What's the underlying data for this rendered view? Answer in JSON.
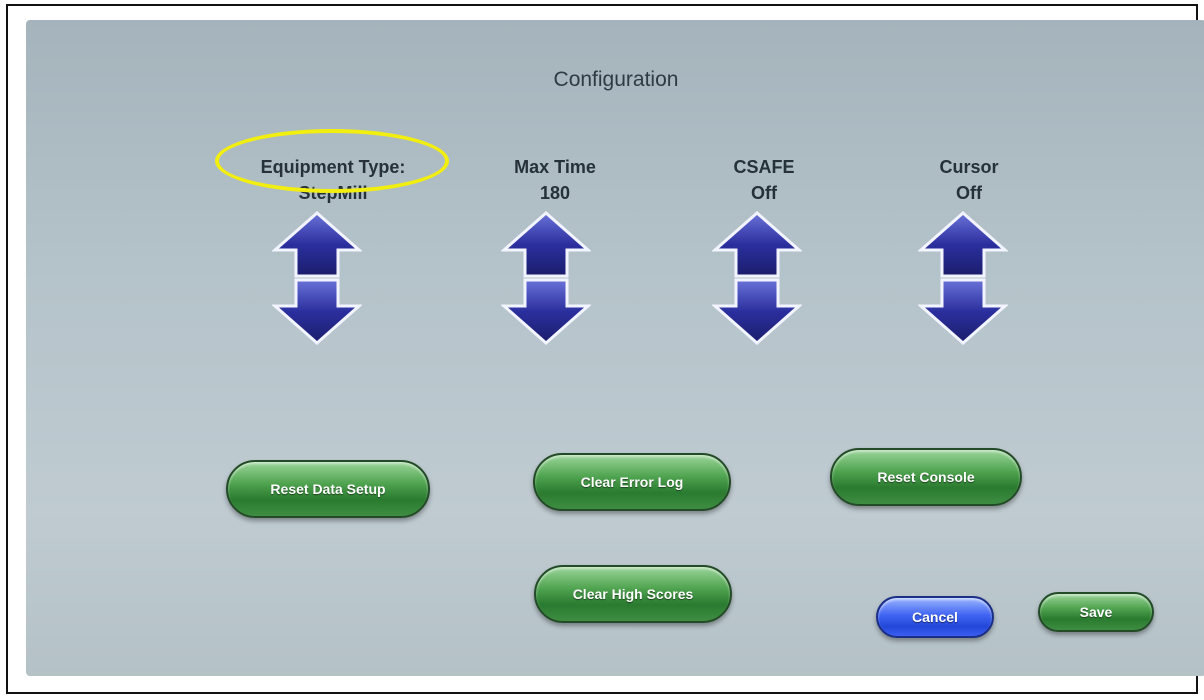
{
  "screen": {
    "title": "Configuration"
  },
  "settings": [
    {
      "label": "Equipment Type:",
      "value": "StepMill"
    },
    {
      "label": "Max Time",
      "value": "180"
    },
    {
      "label": "CSAFE",
      "value": "Off"
    },
    {
      "label": "Cursor",
      "value": "Off"
    }
  ],
  "buttons": {
    "reset_data_setup": "Reset Data Setup",
    "clear_error_log": "Clear Error Log",
    "reset_console": "Reset Console",
    "clear_high_scores": "Clear High Scores",
    "cancel": "Cancel",
    "save": "Save"
  },
  "colors": {
    "arrow": "#2b2f9e",
    "highlight": "#f2ee10",
    "green_button": "#2a7a2f",
    "blue_button": "#2347d8"
  },
  "icons": {
    "up": "arrow-up-icon",
    "down": "arrow-down-icon"
  }
}
